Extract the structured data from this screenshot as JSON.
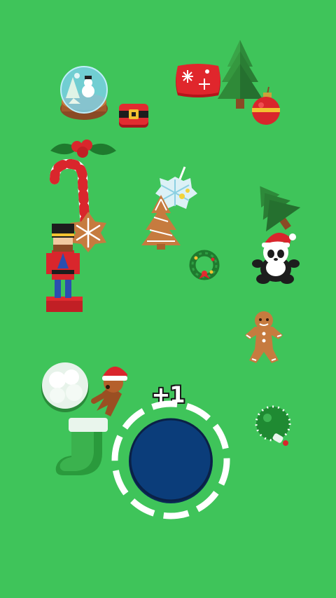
{
  "hud": {
    "score_popup": "+1"
  },
  "colors": {
    "background": "#3fc45a",
    "hole": "#0b3d7a",
    "hole_ring": "#ffffff"
  },
  "items": [
    {
      "name": "snow-globe",
      "icon": "snow-globe-icon"
    },
    {
      "name": "santa-belt-box",
      "icon": "santa-belt-icon"
    },
    {
      "name": "snowflake-pillow",
      "icon": "pillow-icon"
    },
    {
      "name": "pine-tree-top",
      "icon": "pine-tree-icon"
    },
    {
      "name": "red-ornament",
      "icon": "ornament-icon"
    },
    {
      "name": "holly",
      "icon": "holly-icon"
    },
    {
      "name": "candy-cane",
      "icon": "candy-cane-icon"
    },
    {
      "name": "snowflake-cookie",
      "icon": "snowflake-cookie-icon"
    },
    {
      "name": "nutcracker",
      "icon": "nutcracker-icon"
    },
    {
      "name": "snowflake-ornament",
      "icon": "snowflake-icon"
    },
    {
      "name": "tree-cookie",
      "icon": "tree-cookie-icon"
    },
    {
      "name": "wreath",
      "icon": "wreath-icon"
    },
    {
      "name": "fallen-pine-tree",
      "icon": "pine-tree-icon"
    },
    {
      "name": "panda-santa",
      "icon": "panda-icon"
    },
    {
      "name": "gingerbread-man",
      "icon": "gingerbread-icon"
    },
    {
      "name": "snowy-bush",
      "icon": "bush-icon"
    },
    {
      "name": "reindeer-santa",
      "icon": "reindeer-icon"
    },
    {
      "name": "christmas-stocking",
      "icon": "stocking-icon"
    },
    {
      "name": "green-ornament",
      "icon": "ornament-icon"
    },
    {
      "name": "player-hole",
      "icon": "hole-icon"
    }
  ]
}
